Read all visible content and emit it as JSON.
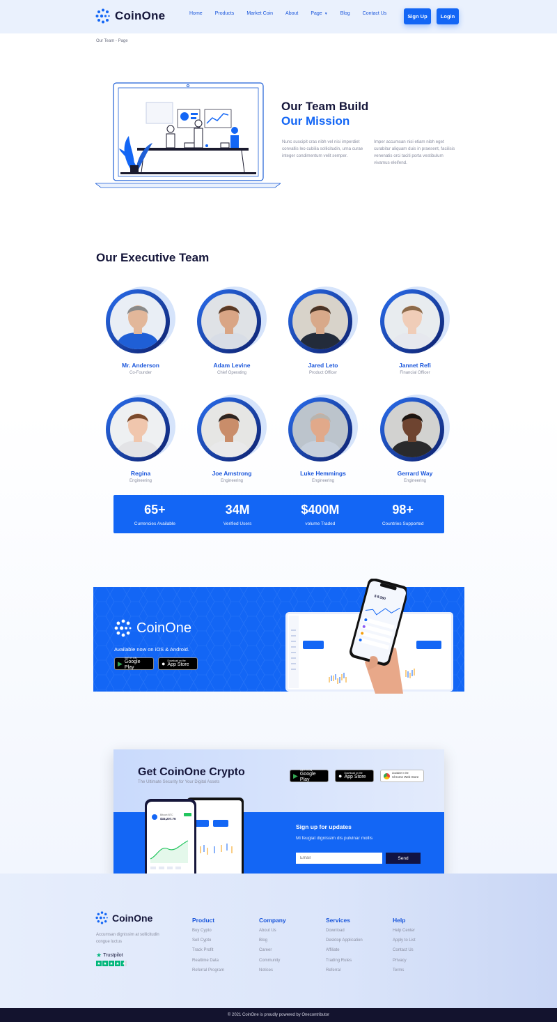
{
  "header": {
    "brand": "CoinOne",
    "nav": [
      {
        "label": "Home"
      },
      {
        "label": "Products"
      },
      {
        "label": "Market Coin"
      },
      {
        "label": "About"
      },
      {
        "label": "Page"
      },
      {
        "label": "Blog"
      },
      {
        "label": "Contact Us"
      }
    ],
    "signup_label": "Sign Up",
    "login_label": "Login"
  },
  "breadcrumb": "Our Team - Page",
  "hero": {
    "title_line1": "Our Team Build",
    "title_line2": "Our Mission",
    "para1": "Nunc suscipit cras nibh vel nisi imperdiet convallis leo cubilia sollicitudin, urna curae integer condimentum velit semper.",
    "para2": "Imper accumsan nisi etiam nibh eget curabitur aliquam  duis in praesent, facilisis venenatis orci taciti porta vestibulum vivamus eleifend."
  },
  "team": {
    "title": "Our Executive Team",
    "members": [
      {
        "name": "Mr. Anderson",
        "role": "Co-Founder",
        "skin": "#e2b79a",
        "hair": "#8a8a8a",
        "shirt": "#1f5fd6",
        "bg": "#e9eef5"
      },
      {
        "name": "Adam Levine",
        "role": "Chief Operating",
        "skin": "#d9a585",
        "hair": "#5a3a26",
        "shirt": "#d8dde6",
        "bg": "#dfe2e6"
      },
      {
        "name": "Jared Leto",
        "role": "Product Officer",
        "skin": "#d8a98a",
        "hair": "#4a3426",
        "shirt": "#232b3a",
        "bg": "#d8d3ca"
      },
      {
        "name": "Jannet Refi",
        "role": "Financial Officer",
        "skin": "#f0cdb8",
        "hair": "#8c6a4a",
        "shirt": "#e6e8ee",
        "bg": "#e8ecef"
      },
      {
        "name": "Regina",
        "role": "Engineering",
        "skin": "#f0c6ad",
        "hair": "#7b4a2c",
        "shirt": "#e3e3e6",
        "bg": "#eef0f2"
      },
      {
        "name": "Joe Amstrong",
        "role": "Engineering",
        "skin": "#c98d6a",
        "hair": "#2d2420",
        "shirt": "#e9e9ea",
        "bg": "#e6e6e4"
      },
      {
        "name": "Luke Hemmings",
        "role": "Engineering",
        "skin": "#e1a98a",
        "hair": "#b8b4ae",
        "shirt": "#c7d0dc",
        "bg": "#bcc4cc"
      },
      {
        "name": "Gerrard Way",
        "role": "Engineering",
        "skin": "#6e4430",
        "hair": "#1b1410",
        "shirt": "#2a2a2c",
        "bg": "#d2d2d0"
      }
    ]
  },
  "stats": [
    {
      "value": "65+",
      "label": "Currencies Available"
    },
    {
      "value": "34M",
      "label": "Verified Users"
    },
    {
      "value": "$400M",
      "label": "volume Traded"
    },
    {
      "value": "98+",
      "label": "Countries Supported"
    }
  ],
  "app_banner": {
    "brand": "CoinOne",
    "available": "Available now on iOS & Android.",
    "google_small": "GET IT ON",
    "google_big": "Google Play",
    "apple_small": "Download on the",
    "apple_big": "App Store"
  },
  "get_app": {
    "title": "Get CoinOne Crypto",
    "subtitle": "The Ultimate Security for Your Digital Assets",
    "cws_small": "Available in the",
    "cws_big": "Chrome Web Store",
    "signup_title": "Sign up for updates",
    "signup_sub": "Mi feugiat dignissim dis pulvinar mollis",
    "email_placeholder": "Email",
    "send_label": "Send"
  },
  "footer": {
    "brand": "CoinOne",
    "description": "Accumsan dignissim at sollicitudin congue luctus",
    "trustpilot": "Trustpilot",
    "columns": [
      {
        "title": "Product",
        "links": [
          "Buy Cypto",
          "Sell Cypto",
          "Track Profit",
          "Realtime Data",
          "Referral Program"
        ]
      },
      {
        "title": "Company",
        "links": [
          "About Us",
          "Blog",
          "Career",
          "Community",
          "Notices"
        ]
      },
      {
        "title": "Services",
        "links": [
          "Download",
          "Desktop Application",
          "Affiliate",
          "Trading Rules",
          "Referral"
        ]
      },
      {
        "title": "Help",
        "links": [
          "Help Center",
          "Apply to List",
          "Contact Us",
          "Privacy",
          "Terms"
        ]
      }
    ],
    "copyright": "© 2021 CoinOne is proudly powered by Onecontributor"
  },
  "colors": {
    "primary": "#1366f5",
    "dark": "#15163a",
    "footer_bar": "#13132e"
  }
}
